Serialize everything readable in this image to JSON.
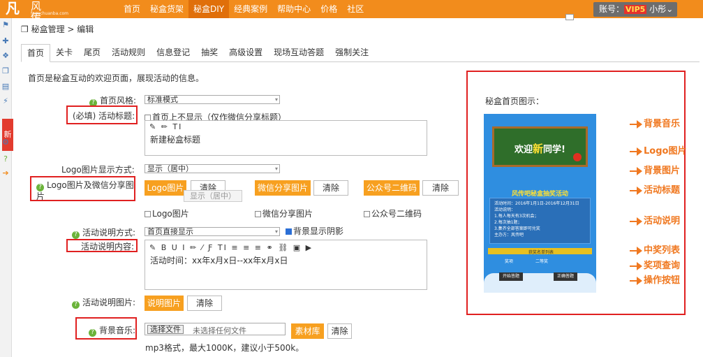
{
  "header": {
    "logo_text": "风传吧",
    "logo_sub": "fengchuanba.com",
    "nav": [
      "首页",
      "秘盒货架",
      "秘盒DIY",
      "经典案例",
      "帮助中心",
      "价格",
      "社区"
    ],
    "account_label": "账号：",
    "vip": "VIP5",
    "user": "小彤",
    "accent": "#f28c1c"
  },
  "sidebar": {
    "badge": "新",
    "icons": [
      "flag-icon",
      "puzzle-icon",
      "cubes-icon",
      "boxes-icon",
      "film-icon",
      "bolt-icon",
      "gears-icon",
      "help-icon",
      "arrow-icon"
    ]
  },
  "breadcrumb": "秘盒管理 > 编辑",
  "tabs": [
    "首页",
    "关卡",
    "尾页",
    "活动规则",
    "信息登记",
    "抽奖",
    "高级设置",
    "现场互动答题",
    "强制关注"
  ],
  "form": {
    "intro": "首页是秘盒互动的欢迎页面，展现活动的信息。",
    "style_label": "首页风格:",
    "style_value": "标准模式",
    "title_label": "(必填) 活动标题:",
    "title_checkbox": "首页上不显示（仅作微信分享标题）",
    "title_toolbar": "✎ ✏ TI",
    "title_value": "新建秘盒标题",
    "logo_mode_label": "Logo图片显示方式:",
    "logo_mode_value": "显示（居中）",
    "logo_share_label": "Logo图片及微信分享图片",
    "logo_button": "Logo图片",
    "share_button": "微信分享图片",
    "qr_button": "公众号二维码",
    "clear": "清除",
    "tooltip": "显示（居中）",
    "logo_cb": "Logo图片",
    "share_cb": "微信分享图片",
    "qr_cb": "公众号二维码",
    "desc_mode_label": "活动说明方式:",
    "desc_mode_value": "首页直接显示",
    "bg_shadow": "背景显示阴影",
    "desc_content_label": "活动说明内容:",
    "desc_toolbar": "✎ B U I ✏ ⁄ Ƒ TI ≡ ≡ ≡ ⚭ ⛓ ▣ ▶",
    "desc_content": "活动时间：xx年x月x日--xx年x月x日",
    "desc_img_label": "活动说明图片:",
    "desc_img_button": "说明图片",
    "music_label": "背景音乐:",
    "file_button": "选择文件",
    "file_status": "未选择任何文件",
    "library_button": "素材库",
    "music_hint": "mp3格式，最大1000K，建议小于500k。"
  },
  "preview": {
    "title": "秘盒首页图示：",
    "board_text_a": "欢迎",
    "board_text_b": "新",
    "board_text_c": "同学!",
    "phone_title": "风传吧秘盒抽奖活动",
    "phone_lines": [
      "活动时间：2016年1月1日-2016年12月31日",
      "活动说明：",
      "1.每人每天有3次机会；",
      "2.每次抽1题；",
      "3.集齐全部答案即可兑奖",
      "主办方：风传吧"
    ],
    "phone_list": "获奖名单列表",
    "phone_left": "奖项",
    "phone_right": "二等奖",
    "phone_btn_a": "开始答题",
    "phone_btn_b": "正确答题",
    "annotations": [
      "背景音乐",
      "Logo图片",
      "背景图片",
      "活动标题",
      "活动说明",
      "中奖列表",
      "奖项查询",
      "操作按钮"
    ],
    "annotation_color": "#f07820"
  }
}
